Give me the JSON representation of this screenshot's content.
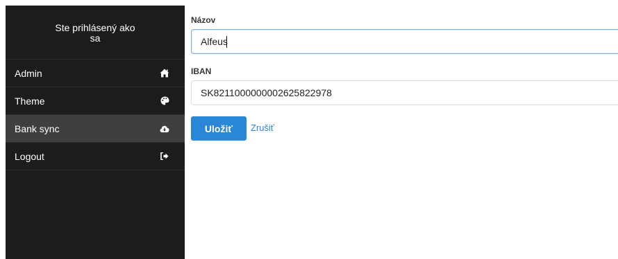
{
  "sidebar": {
    "header_line1": "Ste prihlásený ako",
    "header_line2": "sa",
    "items": [
      {
        "label": "Admin",
        "icon": "home-icon"
      },
      {
        "label": "Theme",
        "icon": "palette-icon"
      },
      {
        "label": "Bank sync",
        "icon": "cloud-download-icon",
        "active": true
      },
      {
        "label": "Logout",
        "icon": "sign-out-icon"
      }
    ]
  },
  "form": {
    "name_label": "Názov",
    "name_value": "Alfeus",
    "iban_label": "IBAN",
    "iban_value": "SK8211000000002625822978",
    "save_label": "Uložiť",
    "cancel_label": "Zrušiť"
  },
  "colors": {
    "sidebar_bg": "#1c1c1c",
    "active_item_bg": "#3f3f3f",
    "primary": "#2a86d6"
  }
}
